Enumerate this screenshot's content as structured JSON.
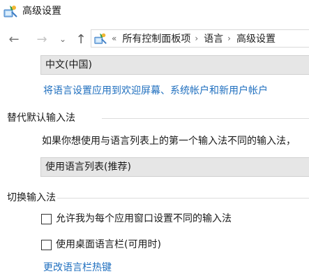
{
  "window": {
    "title": "高级设置",
    "icon": "control-panel-icon"
  },
  "navigation": {
    "back_glyph": "←",
    "forward_glyph": "→",
    "recent_glyph": "⌄",
    "up_glyph": "↑",
    "address": {
      "icon": "control-panel-icon",
      "overflow_glyph": "«",
      "separator_glyph": "›",
      "segments": [
        "所有控制面板项",
        "语言",
        "高级设置"
      ]
    }
  },
  "language": {
    "selected": "中文(中国)",
    "apply_link": "将语言设置应用到欢迎屏幕、系统帐户和新用户帐户"
  },
  "override_input": {
    "heading": "替代默认输入法",
    "description": "如果你想使用与语言列表上的第一个输入法不同的输入法，",
    "selected": "使用语言列表(推荐)"
  },
  "switching": {
    "heading": "切换输入法",
    "options": [
      {
        "label": "允许我为每个应用窗口设置不同的输入法",
        "checked": false
      },
      {
        "label": "使用桌面语言栏(可用时)",
        "checked": false
      }
    ],
    "hotkeys_link": "更改语言栏热键"
  }
}
